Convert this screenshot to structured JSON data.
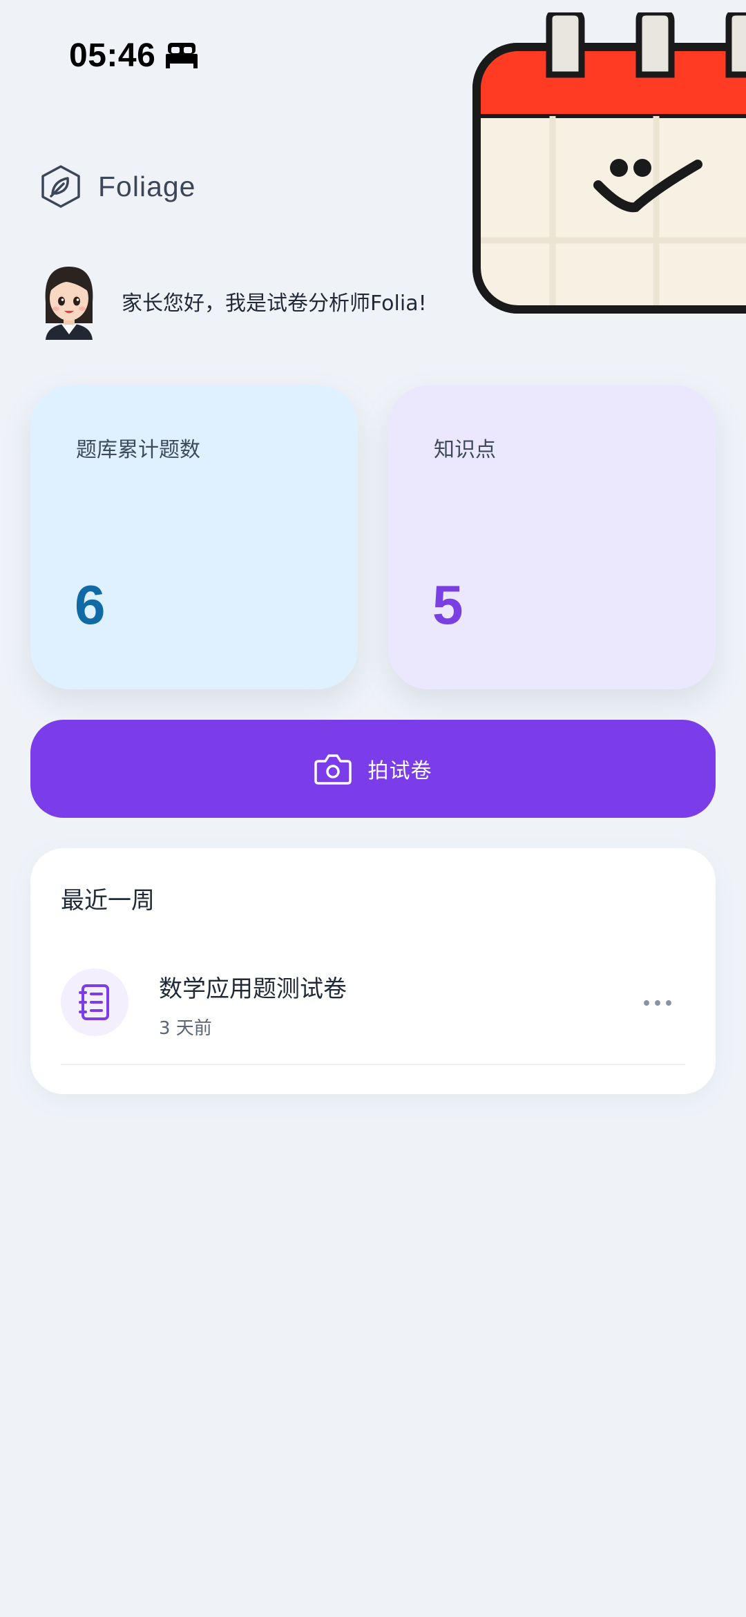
{
  "status_bar": {
    "time": "05:46",
    "mode_icon": "bed-icon"
  },
  "decoration": {
    "icon": "calendar-smile-icon",
    "colors": {
      "header": "#ff3b24",
      "body": "#f7f1e4",
      "outline": "#1a1a1a"
    }
  },
  "brand": {
    "name": "Foliage",
    "logo_icon": "leaf-hexagon-icon"
  },
  "greeting": {
    "text": "家长您好，我是试卷分析师Folia!",
    "avatar_icon": "avatar"
  },
  "stats": {
    "questions": {
      "label": "题库累计题数",
      "value": "6",
      "color": "#0f6aa6",
      "background": "#dff0fe"
    },
    "knowledge": {
      "label": "知识点",
      "value": "5",
      "color": "#7a3fe3",
      "background": "#ebe7fd"
    }
  },
  "capture_button": {
    "label": "拍试卷",
    "icon": "camera-icon",
    "color": "#7b3cea"
  },
  "recent": {
    "title": "最近一周",
    "items": [
      {
        "title": "数学应用题测试卷",
        "time": "3 天前",
        "icon": "notebook-icon",
        "more_icon": "more-icon"
      }
    ]
  },
  "colors": {
    "background": "#eff3f8",
    "accent": "#7b3cea"
  }
}
